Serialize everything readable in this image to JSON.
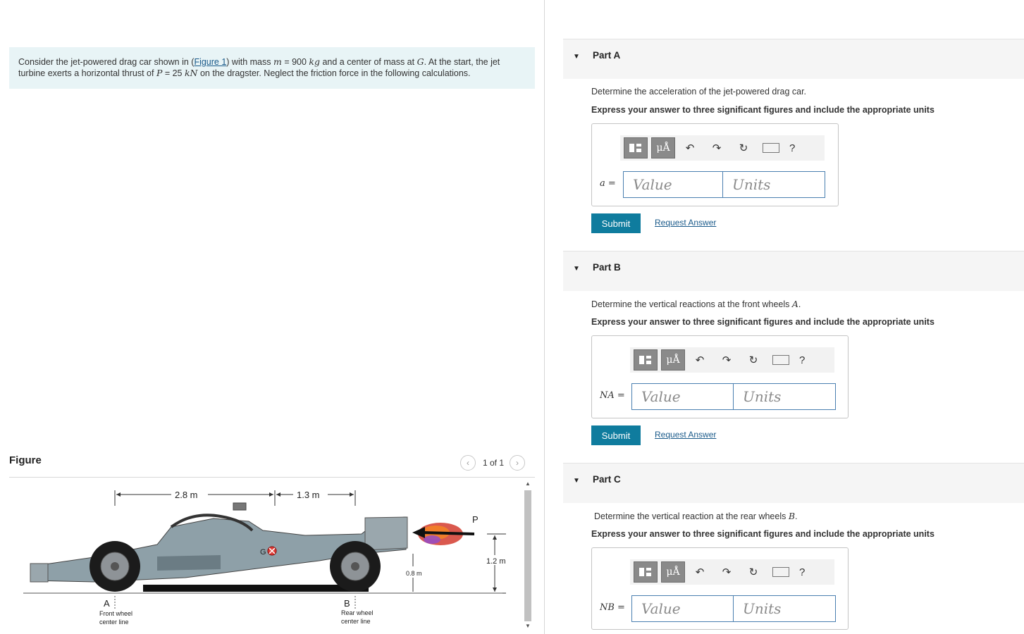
{
  "problem": {
    "intro": "Consider the jet-powered drag car shown in (",
    "figure_link": "Figure 1",
    "text_a": ") with mass ",
    "m_sym": "m",
    "mass": " = 900 ",
    "kg": "kg",
    "text_b": " and a center of mass at ",
    "g_sym": "G",
    "text_c": ". At the start, the jet turbine exerts a horizontal thrust of ",
    "p_sym": "P",
    "thrust": " = 25 ",
    "kn": "kN",
    "text_d": " on the dragster. Neglect the friction force in the following calculations."
  },
  "figure": {
    "title": "Figure",
    "pager": "1 of 1",
    "prev_icon": "chevron-left-icon",
    "next_icon": "chevron-right-icon",
    "dim_a": "2.8 m",
    "dim_b": "1.3 m",
    "dim_height": "1.2 m",
    "dim_small": "0.8 m",
    "label_p": "P",
    "label_g": "G",
    "label_a": "A",
    "label_b": "B",
    "front_wheel_1": "Front wheel",
    "front_wheel_2": "center line",
    "rear_wheel_1": "Rear wheel",
    "rear_wheel_2": "center line"
  },
  "toolbar": {
    "mu": "μÅ",
    "undo_icon": "undo-icon",
    "redo_icon": "redo-icon",
    "reset_icon": "reset-icon",
    "keyboard_icon": "keyboard-icon",
    "help": "?"
  },
  "parts": [
    {
      "title": "Part A",
      "question": "Determine the acceleration of the jet-powered drag car.",
      "instruction": "Express your answer to three significant figures and include the appropriate units",
      "var": "a =",
      "value_placeholder": "Value",
      "units_placeholder": "Units",
      "submit": "Submit",
      "request": "Request Answer"
    },
    {
      "title": "Part B",
      "question": "Determine the vertical reactions at the front wheels ",
      "question_sym": "A",
      "instruction": "Express your answer to three significant figures and include the appropriate units",
      "var": "NA =",
      "value_placeholder": "Value",
      "units_placeholder": "Units",
      "submit": "Submit",
      "request": "Request Answer"
    },
    {
      "title": "Part C",
      "question": "Determine the vertical reaction at the rear wheels ",
      "question_sym": "B",
      "instruction": "Express your answer to three significant figures and include the appropriate units",
      "var": "NB =",
      "value_placeholder": "Value",
      "units_placeholder": "Units"
    }
  ]
}
